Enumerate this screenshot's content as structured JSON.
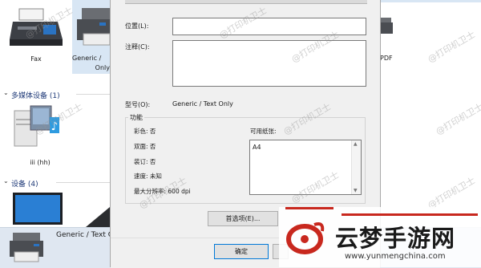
{
  "devices_top": {
    "fax_label": "Fax",
    "generic_label_line1": "Generic /",
    "generic_label_line2": "Only",
    "pdf_label": "PDF"
  },
  "multimedia_group": {
    "title": "多媒体设备 (1)",
    "device_label": "iii (hh)"
  },
  "devices_group": {
    "title": "设备 (4)"
  },
  "status_bar": {
    "selected_device": "Generic / Text O"
  },
  "dialog": {
    "location_label": "位置(L):",
    "location_value": "",
    "comment_label": "注释(C):",
    "comment_value": "",
    "model_label": "型号(O):",
    "model_value": "Generic / Text Only",
    "features_title": "功能",
    "features": {
      "color": "彩色: 否",
      "duplex": "双面: 否",
      "staple": "装订: 否",
      "speed": "速度: 未知",
      "max_resolution": "最大分辨率: 600 dpi"
    },
    "paper_label": "可用纸张:",
    "paper_options": [
      "A4"
    ],
    "preferences_button": "首选项(E)...",
    "ok_button": "确定"
  },
  "watermark": {
    "text": "@打印机卫士",
    "brand_name": "云梦手游网",
    "brand_url": "www.yunmengchina.com"
  },
  "colors": {
    "dialog_bg": "#f0f0f0",
    "header_blue": "#1f3a78",
    "brand_red": "#c8281e"
  }
}
